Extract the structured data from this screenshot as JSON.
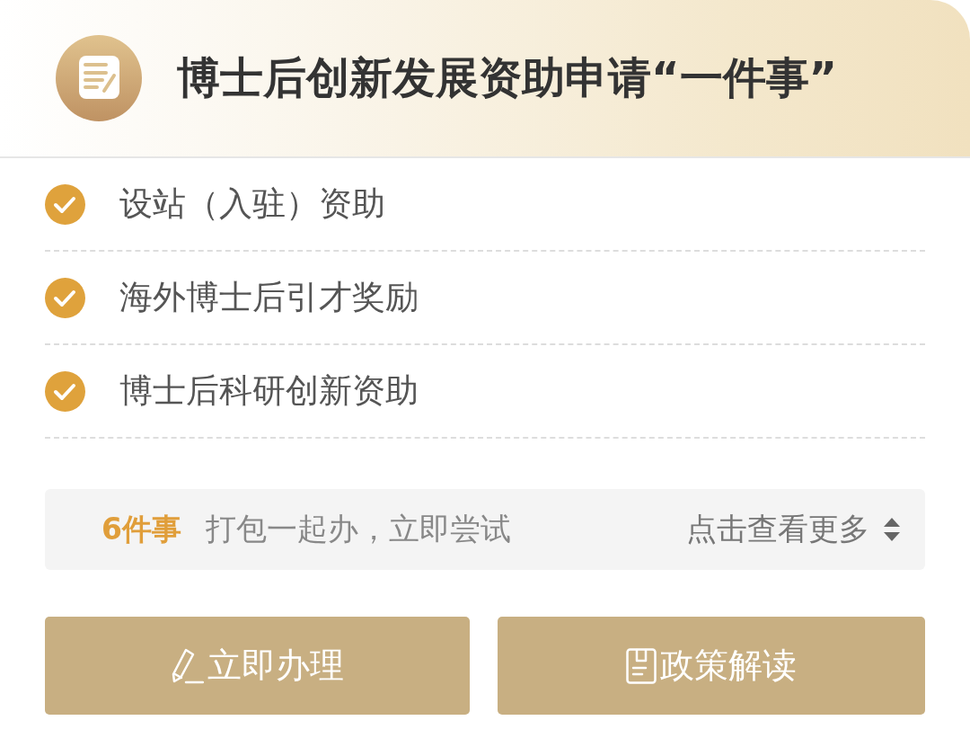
{
  "header": {
    "title": "博士后创新发展资助申请“一件事”"
  },
  "items": [
    {
      "label": "设站（入驻）资助",
      "checked": true
    },
    {
      "label": "海外博士后引才奖励",
      "checked": true
    },
    {
      "label": "博士后科研创新资助",
      "checked": true
    }
  ],
  "summary": {
    "count": "6件事",
    "text": "打包一起办，立即尝试",
    "link": "点击查看更多"
  },
  "buttons": [
    {
      "kind": "edit",
      "label": "立即办理"
    },
    {
      "kind": "document",
      "label": "政策解读"
    }
  ]
}
